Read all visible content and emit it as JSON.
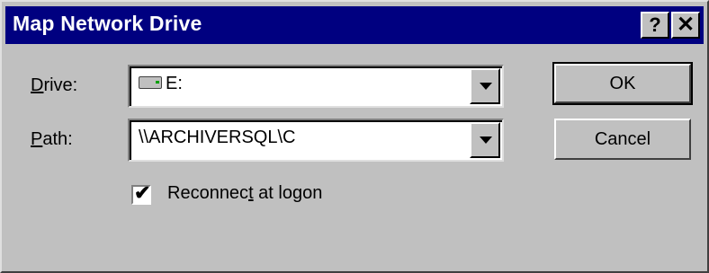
{
  "window": {
    "title": "Map Network Drive",
    "help_label": "?",
    "close_label": "✕"
  },
  "drive": {
    "label_underline": "D",
    "label_rest": "rive:",
    "value": "E:"
  },
  "path": {
    "label_underline": "P",
    "label_rest": "ath:",
    "value": "\\\\ARCHIVERSQL\\C"
  },
  "reconnect": {
    "checked": true,
    "check_glyph": "✔",
    "label_pre": "Reconnec",
    "label_underline": "t",
    "label_post": " at logon"
  },
  "buttons": {
    "ok": "OK",
    "cancel": "Cancel"
  }
}
